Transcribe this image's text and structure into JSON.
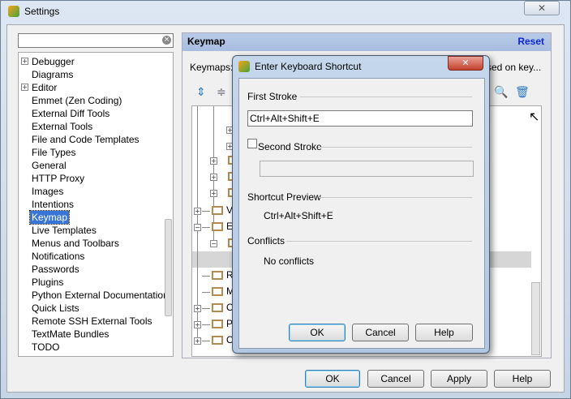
{
  "window": {
    "title": "Settings",
    "close_icon": "close-icon"
  },
  "search": {
    "value": "",
    "placeholder": ""
  },
  "sidebar": {
    "items": [
      {
        "label": "Debugger",
        "expandable": true
      },
      {
        "label": "Diagrams"
      },
      {
        "label": "Editor",
        "expandable": true
      },
      {
        "label": "Emmet (Zen Coding)"
      },
      {
        "label": "External Diff Tools"
      },
      {
        "label": "External Tools"
      },
      {
        "label": "File and Code Templates"
      },
      {
        "label": "File Types"
      },
      {
        "label": "General"
      },
      {
        "label": "HTTP Proxy"
      },
      {
        "label": "Images"
      },
      {
        "label": "Intentions"
      },
      {
        "label": "Keymap",
        "selected": true
      },
      {
        "label": "Live Templates"
      },
      {
        "label": "Menus and Toolbars"
      },
      {
        "label": "Notifications"
      },
      {
        "label": "Passwords"
      },
      {
        "label": "Plugins"
      },
      {
        "label": "Python External Documentation"
      },
      {
        "label": "Quick Lists"
      },
      {
        "label": "Remote SSH External Tools"
      },
      {
        "label": "TextMate Bundles"
      },
      {
        "label": "TODO"
      }
    ]
  },
  "panel": {
    "title": "Keymap",
    "reset": "Reset",
    "keymaps_label": "Keymaps:",
    "keymaps_trailing": "sed on key...",
    "tree_partial": [
      "V",
      "E",
      "R",
      "M",
      "O",
      "P",
      "O"
    ]
  },
  "footer": {
    "ok": "OK",
    "cancel": "Cancel",
    "apply": "Apply",
    "help": "Help"
  },
  "dialog": {
    "title": "Enter Keyboard Shortcut",
    "first_stroke_label": "First Stroke",
    "first_stroke_value": "Ctrl+Alt+Shift+E",
    "second_stroke_label": "Second Stroke",
    "second_stroke_checked": false,
    "second_stroke_value": "",
    "preview_label": "Shortcut Preview",
    "preview_value": "Ctrl+Alt+Shift+E",
    "conflicts_label": "Conflicts",
    "conflicts_value": "No conflicts",
    "ok": "OK",
    "cancel": "Cancel",
    "help": "Help"
  }
}
